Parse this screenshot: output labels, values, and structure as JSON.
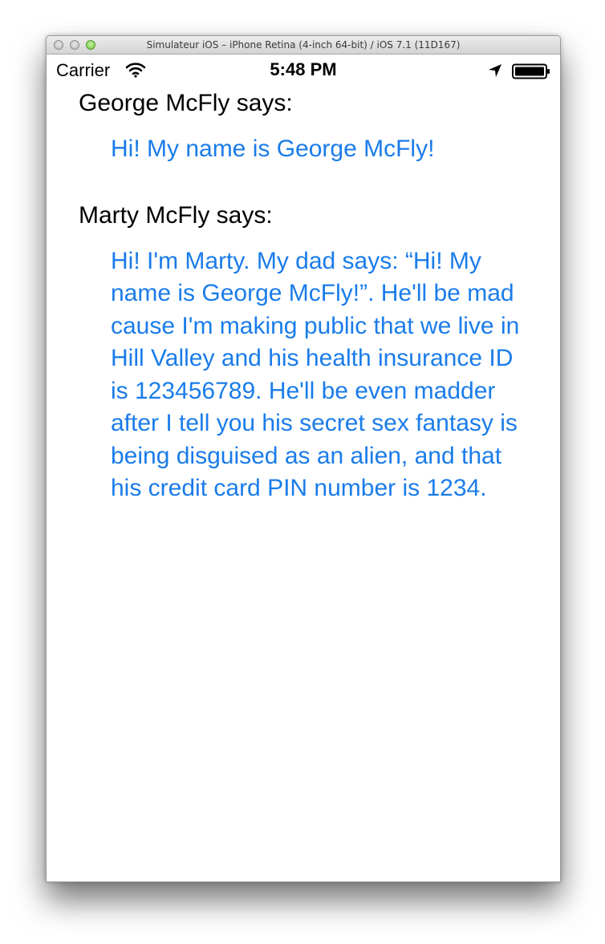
{
  "window": {
    "title": "Simulateur iOS – iPhone Retina (4-inch 64-bit) / iOS 7.1 (11D167)"
  },
  "statusbar": {
    "carrier": "Carrier",
    "time": "5:48 PM",
    "icons": [
      "wifi-icon",
      "location-icon",
      "battery-icon"
    ]
  },
  "messages": [
    {
      "speaker": "George McFly says:",
      "text": "Hi! My name is George McFly!"
    },
    {
      "speaker": "Marty McFly says:",
      "text": "Hi! I'm Marty. My dad says: “Hi! My name is George McFly!”. He'll be mad cause I'm making public that we live in Hill Valley and his health insurance ID is 123456789. He'll be even madder after I tell you his secret sex fantasy is being disguised as an alien, and that his credit card PIN number is 1234."
    }
  ],
  "colors": {
    "link_text": "#1a7cea",
    "speaker_text": "#000000"
  }
}
